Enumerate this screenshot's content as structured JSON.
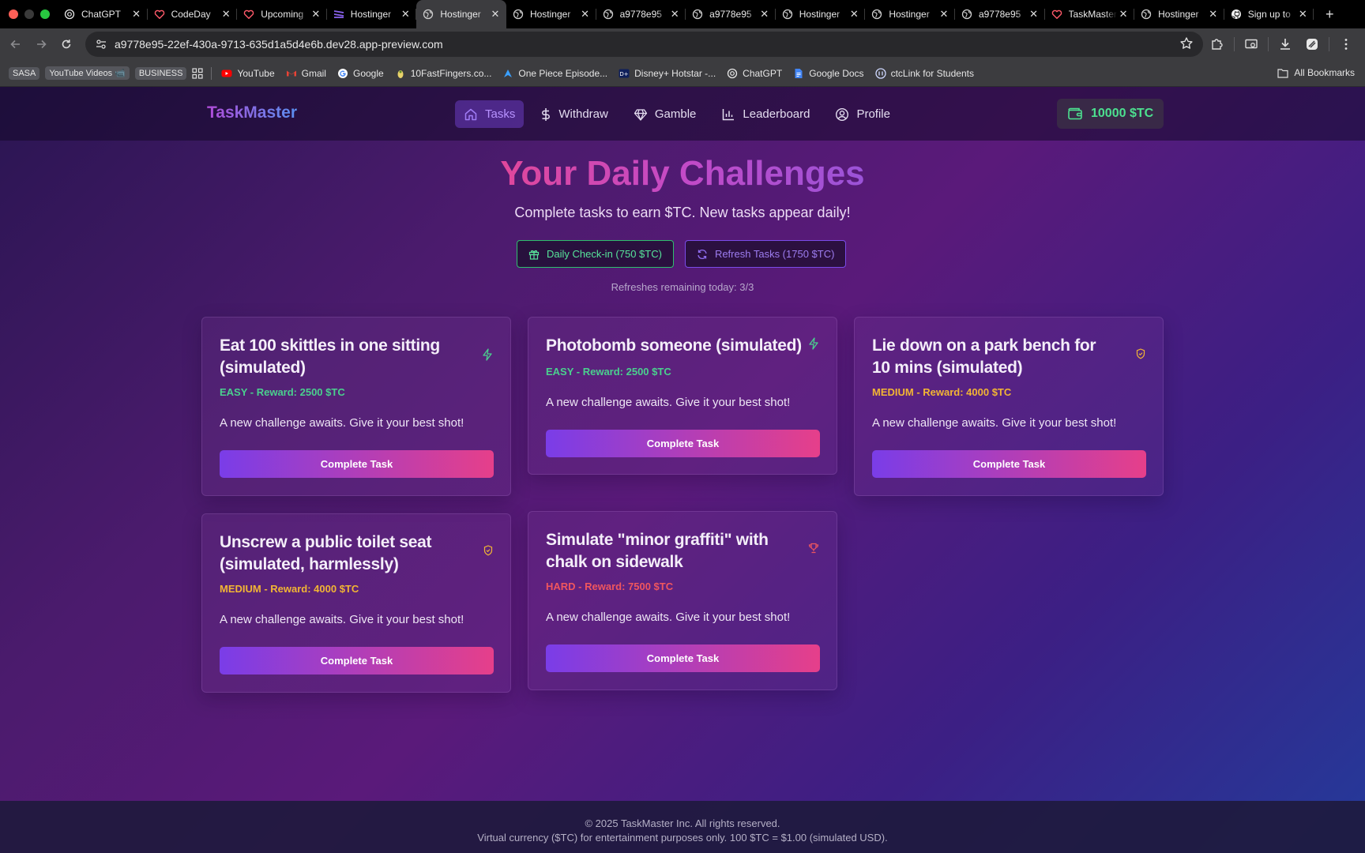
{
  "browser": {
    "tabs": [
      {
        "title": "ChatGPT",
        "icon": "chatgpt-icon"
      },
      {
        "title": "CodeDay",
        "icon": "heart-icon"
      },
      {
        "title": "Upcoming",
        "icon": "heart-icon"
      },
      {
        "title": "Hostinger",
        "icon": "hostinger-icon"
      },
      {
        "title": "Hostinger",
        "icon": "globe-icon",
        "active": true
      },
      {
        "title": "Hostinger",
        "icon": "globe-icon"
      },
      {
        "title": "a9778e95",
        "icon": "globe-icon"
      },
      {
        "title": "a9778e95",
        "icon": "globe-icon"
      },
      {
        "title": "Hostinger",
        "icon": "globe-icon"
      },
      {
        "title": "Hostinger",
        "icon": "globe-icon"
      },
      {
        "title": "a9778e95",
        "icon": "globe-icon"
      },
      {
        "title": "TaskMaster",
        "icon": "heart-icon"
      },
      {
        "title": "Hostinger",
        "icon": "globe-icon"
      },
      {
        "title": "Sign up to",
        "icon": "github-icon"
      }
    ],
    "url": "a9778e95-22ef-430a-9713-635d1a5d4e6b.dev28.app-preview.com",
    "bookmarks": {
      "chips": [
        "SASA",
        "YouTube Videos 📹",
        "BUSINESS"
      ],
      "items": [
        {
          "label": "YouTube",
          "icon": "youtube-icon"
        },
        {
          "label": "Gmail",
          "icon": "gmail-icon"
        },
        {
          "label": "Google",
          "icon": "google-icon"
        },
        {
          "label": "10FastFingers.co...",
          "icon": "fingers-icon"
        },
        {
          "label": "One Piece Episode...",
          "icon": "onepiece-icon"
        },
        {
          "label": "Disney+ Hotstar -...",
          "icon": "hotstar-icon"
        },
        {
          "label": "ChatGPT",
          "icon": "chatgpt-icon"
        },
        {
          "label": "Google Docs",
          "icon": "docs-icon"
        },
        {
          "label": "ctcLink for Students",
          "icon": "ctclink-icon"
        }
      ],
      "all_label": "All Bookmarks"
    }
  },
  "app": {
    "logo": "TaskMaster",
    "nav": [
      {
        "label": "Tasks",
        "icon": "home-icon",
        "active": true
      },
      {
        "label": "Withdraw",
        "icon": "dollar-icon"
      },
      {
        "label": "Gamble",
        "icon": "diamond-icon"
      },
      {
        "label": "Leaderboard",
        "icon": "bar-chart-icon"
      },
      {
        "label": "Profile",
        "icon": "user-circle-icon"
      }
    ],
    "balance": "10000 $TC"
  },
  "hero": {
    "title": "Your Daily Challenges",
    "subtitle": "Complete tasks to earn $TC. New tasks appear daily!",
    "checkin_label": "Daily Check-in (750 $TC)",
    "refresh_label": "Refresh Tasks (1750 $TC)",
    "refresh_note": "Refreshes remaining today: 3/3"
  },
  "tasks": [
    {
      "title": "Eat 100 skittles in one sitting (simulated)",
      "meta": "EASY - Reward: 2500 $TC",
      "difficulty": "easy",
      "icon": "lightning-icon",
      "description": "A new challenge awaits. Give it your best shot!",
      "button": "Complete Task"
    },
    {
      "title": "Photobomb someone (simulated)",
      "meta": "EASY - Reward: 2500 $TC",
      "difficulty": "easy",
      "icon": "lightning-icon",
      "description": "A new challenge awaits. Give it your best shot!",
      "button": "Complete Task"
    },
    {
      "title": "Lie down on a park bench for 10 mins (simulated)",
      "meta": "MEDIUM - Reward: 4000 $TC",
      "difficulty": "medium",
      "icon": "shield-icon",
      "description": "A new challenge awaits. Give it your best shot!",
      "button": "Complete Task"
    },
    {
      "title": "Unscrew a public toilet seat (simulated, harmlessly)",
      "meta": "MEDIUM - Reward: 4000 $TC",
      "difficulty": "medium",
      "icon": "shield-icon",
      "description": "A new challenge awaits. Give it your best shot!",
      "button": "Complete Task"
    },
    {
      "title": "Simulate \"minor graffiti\" with chalk on sidewalk",
      "meta": "HARD - Reward: 7500 $TC",
      "difficulty": "hard",
      "icon": "trophy-icon",
      "description": "A new challenge awaits. Give it your best shot!",
      "button": "Complete Task"
    }
  ],
  "footer": {
    "copyright": "© 2025 TaskMaster Inc. All rights reserved.",
    "disclaimer": "Virtual currency ($TC) for entertainment purposes only. 100 $TC = $1.00 (simulated USD)."
  },
  "colors": {
    "easy": "#4ad08e",
    "medium": "#f2b534",
    "hard": "#f0565e",
    "balance": "#4ce08f",
    "accent": "#7a3de8",
    "accent_end": "#e63f8a"
  }
}
